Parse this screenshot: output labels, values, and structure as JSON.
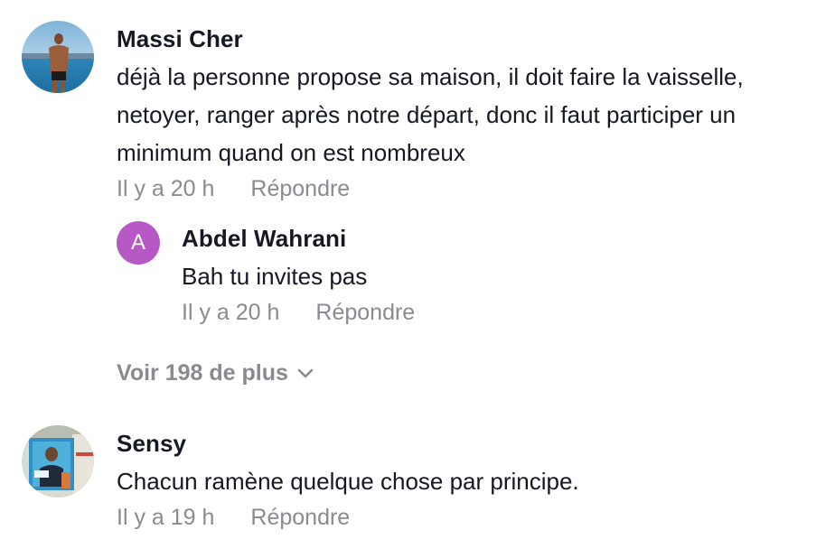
{
  "comments": [
    {
      "author": "Massi Cher",
      "text_lines": [
        "déjà la personne propose sa maison, il doit faire la vaisselle,",
        "netoyer, ranger après notre départ, donc il faut participer un",
        "minimum quand on est nombreux"
      ],
      "time": "Il y a 20 h",
      "reply_label": "Répondre",
      "replies": [
        {
          "avatar_letter": "A",
          "avatar_color": "#b759c4",
          "author": "Abdel Wahrani",
          "text": "Bah tu invites pas",
          "time": "Il y a 20 h",
          "reply_label": "Répondre"
        }
      ],
      "more_replies_label": "Voir 198 de plus",
      "more_icon": "chevron-down-icon"
    },
    {
      "author": "Sensy",
      "text": "Chacun ramène quelque chose par principe.",
      "time": "Il y a 19 h",
      "reply_label": "Répondre"
    }
  ],
  "colors": {
    "text": "#161823",
    "meta": "#8a8b91",
    "reply_avatar": "#b759c4"
  }
}
